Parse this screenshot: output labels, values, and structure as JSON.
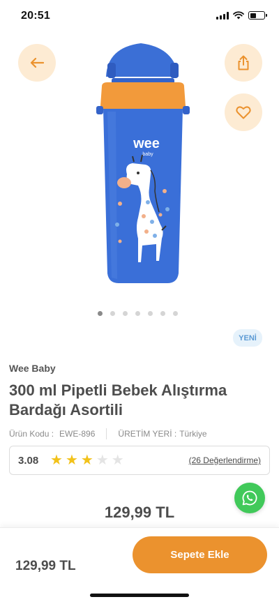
{
  "status": {
    "time": "20:51"
  },
  "icons": {
    "back": "arrow-left-icon",
    "share": "share-icon",
    "favorite": "heart-icon",
    "whatsapp": "whatsapp-icon"
  },
  "product_image": {
    "logo_text": "wee",
    "logo_subtext": "baby"
  },
  "carousel": {
    "count": 7,
    "active_index": 0
  },
  "badge": {
    "label": "YENİ"
  },
  "product": {
    "brand": "Wee Baby",
    "title": "300 ml Pipetli Bebek Alıştırma Bardağı  Asortili",
    "code_label": "Ürün Kodu :",
    "code_value": "EWE-896",
    "origin_label": "ÜRETİM YERİ :",
    "origin_value": "Türkiye",
    "price": "129,99 TL"
  },
  "rating": {
    "value": "3.08",
    "stars_filled": 3,
    "stars_total": 5,
    "review_count_text": "(26 Değerlendirme)"
  },
  "bottom_bar": {
    "price": "129,99 TL",
    "add_to_cart_label": "Sepete Ekle"
  },
  "colors": {
    "accent_orange": "#eb922e",
    "button_bg": "#fdebd3",
    "badge_bg": "#e6f2fb",
    "badge_text": "#5b9ad4",
    "star_on": "#f2c21a",
    "whatsapp_green": "#41c95a",
    "cup_blue": "#3a6fd8"
  }
}
